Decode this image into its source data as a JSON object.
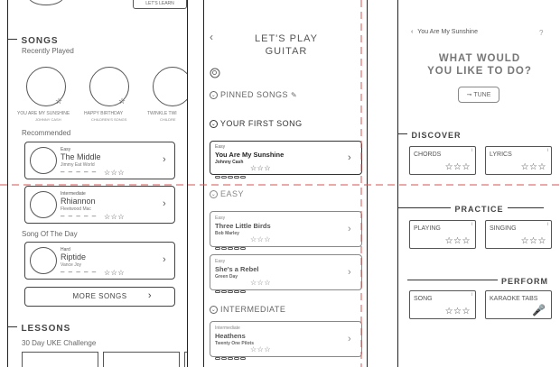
{
  "panel1": {
    "top_button_label": "LET'S LEARN",
    "songs_header": "SONGS",
    "recently_played_label": "Recently Played",
    "recent": [
      {
        "title": "YOU ARE MY SUNSHINE",
        "artist": "JOHNNY CASH"
      },
      {
        "title": "HAPPY BIRTHDAY",
        "artist": "CHILDREN'S SONGS"
      },
      {
        "title": "TWINKLE TWI",
        "artist": "CHILDRE"
      }
    ],
    "recommended_label": "Recommended",
    "recommended": [
      {
        "level": "Easy",
        "title": "The Middle",
        "artist": "Jimmy Eat World",
        "stars": "☆☆☆"
      },
      {
        "level": "Intermediate",
        "title": "Rhiannon",
        "artist": "Fleetwood Mac",
        "stars": "☆☆☆"
      }
    ],
    "song_of_day_label": "Song Of The Day",
    "song_of_day": {
      "level": "Hard",
      "title": "Riptide",
      "artist": "Vance Joy",
      "stars": "☆☆☆"
    },
    "more_songs_label": "MORE SONGS",
    "lessons_header": "LESSONS",
    "challenge_label": "30 Day UKE Challenge"
  },
  "panel2": {
    "title_line1": "LET'S PLAY",
    "title_line2": "GUITAR",
    "pinned_label": "PINNED SONGS",
    "first_song_label": "YOUR FIRST SONG",
    "first_song": {
      "level": "Easy",
      "title": "You Are My Sunshine",
      "artist": "Johnny Cash",
      "stars": "☆☆☆"
    },
    "easy_label": "EASY",
    "easy_songs": [
      {
        "level": "Easy",
        "title": "Three Little Birds",
        "artist": "Bob Marley",
        "stars": "☆☆☆"
      },
      {
        "level": "Easy",
        "title": "She's a Rebel",
        "artist": "Green Day",
        "stars": "☆☆☆"
      }
    ],
    "intermediate_label": "INTERMEDIATE",
    "intermediate_songs": [
      {
        "level": "Intermediate",
        "title": "Heathens",
        "artist": "Twenty One Pilots",
        "stars": "☆☆☆"
      }
    ]
  },
  "panel3": {
    "back_label": "You Are My Sunshine",
    "help_label": "?",
    "question_line1": "WHAT WOULD",
    "question_line2": "YOU LIKE TO DO?",
    "tune_label": "TUNE",
    "discover_label": "DISCOVER",
    "discover": [
      {
        "label": "CHORDS",
        "stars": "☆☆☆"
      },
      {
        "label": "LYRICS",
        "stars": "☆☆☆"
      }
    ],
    "practice_label": "PRACTICE",
    "practice": [
      {
        "label": "PLAYING",
        "stars": "☆☆☆"
      },
      {
        "label": "SINGING",
        "stars": "☆☆☆"
      }
    ],
    "perform_label": "PERFORM",
    "perform": [
      {
        "label": "SONG",
        "stars": "☆☆☆"
      },
      {
        "label": "KARAOKE TABS"
      }
    ]
  },
  "colors": {
    "guide": "#d9534f",
    "ink": "#333333"
  }
}
